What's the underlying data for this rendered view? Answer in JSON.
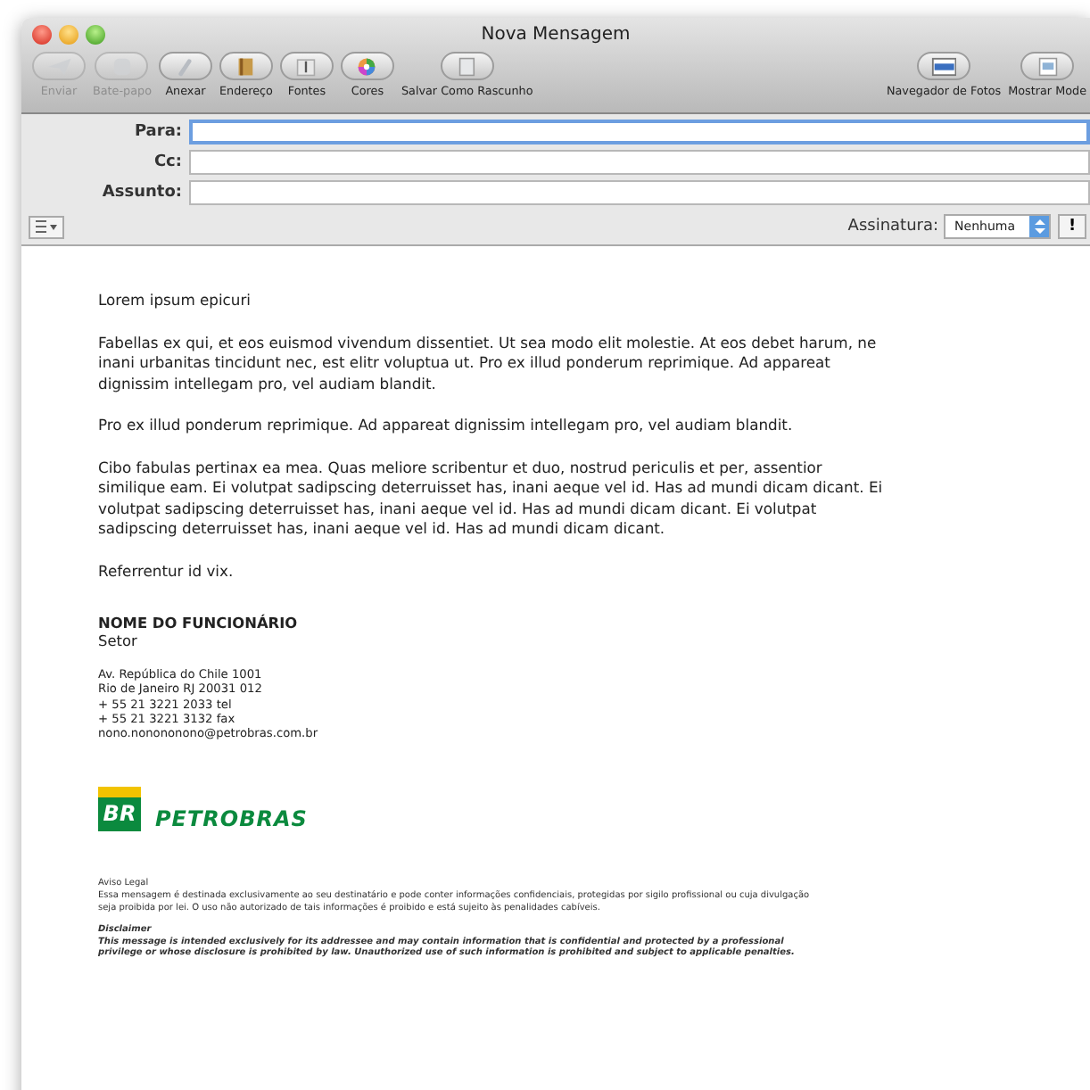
{
  "window": {
    "title": "Nova Mensagem"
  },
  "toolbar": [
    {
      "label": "Enviar",
      "disabled": true,
      "kind": "send"
    },
    {
      "label": "Bate-papo",
      "disabled": true,
      "kind": "chat"
    },
    {
      "label": "Anexar",
      "disabled": false,
      "kind": "attach"
    },
    {
      "label": "Endereço",
      "disabled": false,
      "kind": "address"
    },
    {
      "label": "Fontes",
      "disabled": false,
      "kind": "fonts"
    },
    {
      "label": "Cores",
      "disabled": false,
      "kind": "colors"
    },
    {
      "label": "Salvar Como Rascunho",
      "disabled": false,
      "kind": "draft"
    }
  ],
  "toolbar_right": [
    {
      "label": "Navegador de Fotos",
      "disabled": false,
      "kind": "photos"
    },
    {
      "label": "Mostrar Mode",
      "disabled": false,
      "kind": "stationery"
    }
  ],
  "fields": [
    {
      "label": "Para:",
      "focused": true
    },
    {
      "label": "Cc:",
      "focused": false
    },
    {
      "label": "Assunto:",
      "focused": false
    }
  ],
  "signature": {
    "label": "Assinatura:",
    "value": "Nenhuma",
    "priority": "!"
  },
  "body": {
    "paragraphs": [
      "Lorem ipsum epicuri",
      "Fabellas ex qui, et eos euismod vivendum dissentiet. Ut sea modo elit molestie. At eos debet harum, ne inani urbanitas tincidunt nec, est elitr voluptua ut. Pro ex illud ponderum reprimique. Ad appareat dignissim intellegam pro, vel audiam blandit.",
      "Pro ex illud ponderum reprimique. Ad appareat dignissim intellegam pro, vel audiam blandit.",
      "Cibo fabulas pertinax ea mea. Quas meliore scribentur et duo, nostrud periculis et per, assentior similique eam. Ei volutpat sadipscing deterruisset has, inani aeque vel id. Has ad mundi dicam dicant. Ei volutpat sadipscing deterruisset has, inani aeque vel id. Has ad mundi dicam dicant. Ei volutpat sadipscing deterruisset has, inani aeque vel id. Has ad mundi dicam dicant.",
      "Referrentur id vix."
    ]
  },
  "signature_block": {
    "name": "NOME DO FUNCIONÁRIO",
    "department": "Setor",
    "address": [
      "Av. República do Chile 1001",
      "Rio de Janeiro  RJ  20031 012",
      "+ 55  21  3221  2033  tel",
      "+ 55  21  3221  3132  fax",
      "nono.nonononono@petrobras.com.br"
    ],
    "logo_mark": "BR",
    "logo_text": "PETROBRAS",
    "legal_title": "Aviso Legal",
    "legal_text": "Essa mensagem é destinada exclusivamente ao seu destinatário e pode conter informações confidenciais, protegidas por sigilo profissional ou cuja divulgação seja proibida por lei. O uso não autorizado de tais informações é proibido e está sujeito às penalidades cabíveis.",
    "disclaimer_title": "Disclaimer",
    "disclaimer_text": "This message is intended exclusively for its addressee and may contain information that is confidential and protected by a professional privilege or whose disclosure is prohibited by law. Unauthorized use of such information is prohibited and subject to applicable penalties."
  }
}
